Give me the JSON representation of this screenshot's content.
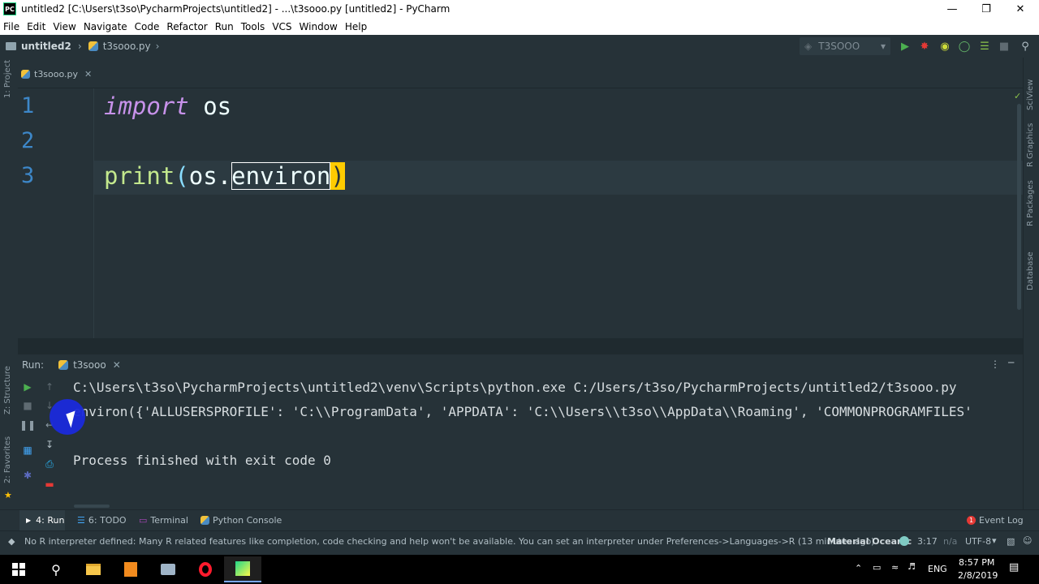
{
  "window": {
    "title": "untitled2 [C:\\Users\\t3so\\PycharmProjects\\untitled2] - ...\\t3sooo.py [untitled2] - PyCharm",
    "app_icon": "PC",
    "controls": [
      "minimize-icon",
      "restore-icon",
      "close-icon"
    ]
  },
  "menu": [
    "File",
    "Edit",
    "View",
    "Navigate",
    "Code",
    "Refactor",
    "Run",
    "Tools",
    "VCS",
    "Window",
    "Help"
  ],
  "breadcrumb": {
    "project": "untitled2",
    "file": "t3sooo.py"
  },
  "run_config": "T3SOOO",
  "left_strip": {
    "project": "1: Project",
    "structure": "Z: Structure",
    "favorites": "2: Favorites"
  },
  "right_strip": [
    "SciView",
    "R Graphics",
    "R Packages",
    "Database"
  ],
  "editor": {
    "tab": "t3sooo.py",
    "lines": [
      {
        "num": "1",
        "kw": "import",
        "rest": " os"
      },
      {
        "num": "2"
      },
      {
        "num": "3",
        "fn": "print",
        "open": "(",
        "obj": "os.",
        "sel": "environ",
        "close": ")"
      }
    ]
  },
  "run_panel": {
    "label": "Run:",
    "tab": "t3sooo",
    "output": [
      "C:\\Users\\t3so\\PycharmProjects\\untitled2\\venv\\Scripts\\python.exe C:/Users/t3so/PycharmProjects/untitled2/t3sooo.py",
      "environ({'ALLUSERSPROFILE': 'C:\\\\ProgramData', 'APPDATA': 'C:\\\\Users\\\\t3so\\\\AppData\\\\Roaming', 'COMMONPROGRAMFILES'",
      "",
      "Process finished with exit code 0"
    ]
  },
  "tool_tabs": {
    "run": "4: Run",
    "todo": "6: TODO",
    "terminal": "Terminal",
    "python_console": "Python Console",
    "event_log": "Event Log",
    "event_count": "1"
  },
  "status": {
    "message": "No R interpreter defined: Many R related features like completion, code checking and help won't be available. You can set an interpreter under Preferences->Languages->R (13 minutes ago)",
    "theme": "Material Oceanic",
    "position": "3:17",
    "na": "n/a",
    "encoding": "UTF-8"
  },
  "taskbar": {
    "time": "8:57 PM",
    "date": "2/8/2019",
    "lang": "ENG"
  },
  "colors": {
    "bg": "#263238",
    "keyword": "#c792ea",
    "function": "#c3e88d",
    "linenum": "#3d87c8",
    "brace_match": "#ffcc00"
  }
}
